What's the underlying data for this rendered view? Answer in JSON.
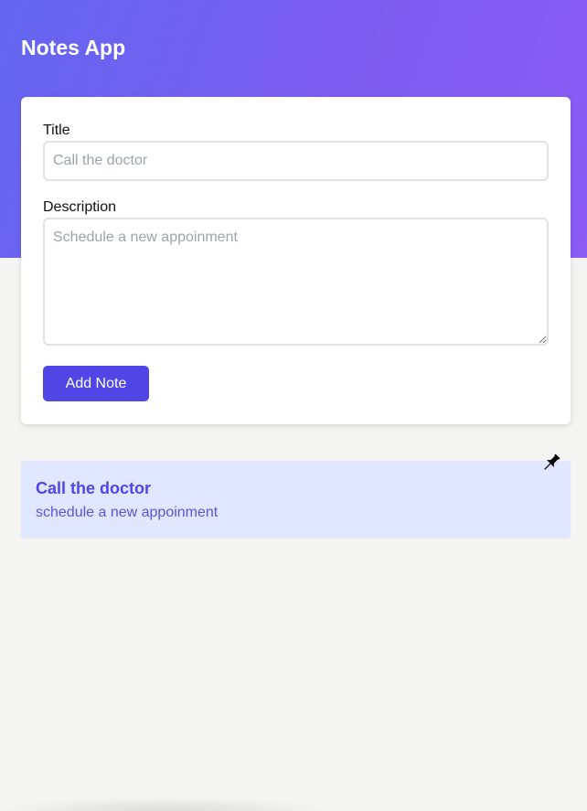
{
  "app": {
    "title": "Notes App"
  },
  "form": {
    "title_label": "Title",
    "title_placeholder": "Call the doctor",
    "description_label": "Description",
    "description_placeholder": "Schedule a new appoinment",
    "submit_label": "Add Note"
  },
  "notes": [
    {
      "title": "Call the doctor",
      "description": "schedule a new appoinment",
      "icon": "pushpin-icon"
    }
  ],
  "colors": {
    "header_gradient_start": "#6366f1",
    "header_gradient_end": "#8b5cf6",
    "accent": "#4f46e5",
    "note_background": "#e0e7ff",
    "page_background": "#f4f4f2"
  }
}
